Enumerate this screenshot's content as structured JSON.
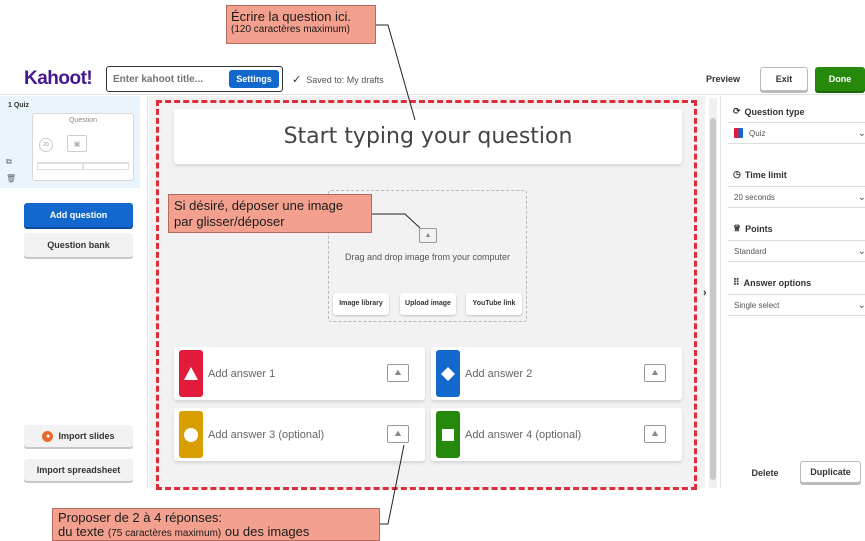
{
  "callouts": {
    "question": {
      "line1": "Écrire la question ici.",
      "line2": "(120 caractères maximum)"
    },
    "image": {
      "line1": "Si désiré, déposer une image",
      "line2": "par glisser/déposer"
    },
    "answers": {
      "line1": "Proposer de 2 à 4 réponses:",
      "line2_a": "du texte ",
      "line2_b": "(75 caractères maximum)",
      "line2_c": " ou des images"
    }
  },
  "header": {
    "logo": "Kahoot!",
    "title_placeholder": "Enter kahoot title...",
    "settings": "Settings",
    "saved": "Saved to: My drafts",
    "preview": "Preview",
    "exit": "Exit",
    "done": "Done"
  },
  "sidebar": {
    "slide_label": "1  Quiz",
    "thumb_title": "Question",
    "thumb_timer": "20",
    "add_question": "Add question",
    "question_bank": "Question bank",
    "import_slides": "Import slides",
    "import_spreadsheet": "Import spreadsheet"
  },
  "editor": {
    "question_placeholder": "Start typing your question",
    "media_text": "Drag and drop image from your computer",
    "media_buttons": [
      "Image library",
      "Upload image",
      "YouTube link"
    ],
    "answers": [
      {
        "label": "Add answer 1",
        "color": "#e21b3c",
        "shape": "triangle"
      },
      {
        "label": "Add answer 2",
        "color": "#1368ce",
        "shape": "diamond"
      },
      {
        "label": "Add answer 3 (optional)",
        "color": "#d89e00",
        "shape": "circle"
      },
      {
        "label": "Add answer 4 (optional)",
        "color": "#26890c",
        "shape": "square"
      }
    ]
  },
  "right_panel": {
    "question_type_label": "Question type",
    "question_type_value": "Quiz",
    "time_limit_label": "Time limit",
    "time_limit_value": "20 seconds",
    "points_label": "Points",
    "points_value": "Standard",
    "answer_options_label": "Answer options",
    "answer_options_value": "Single select",
    "delete": "Delete",
    "duplicate": "Duplicate"
  }
}
